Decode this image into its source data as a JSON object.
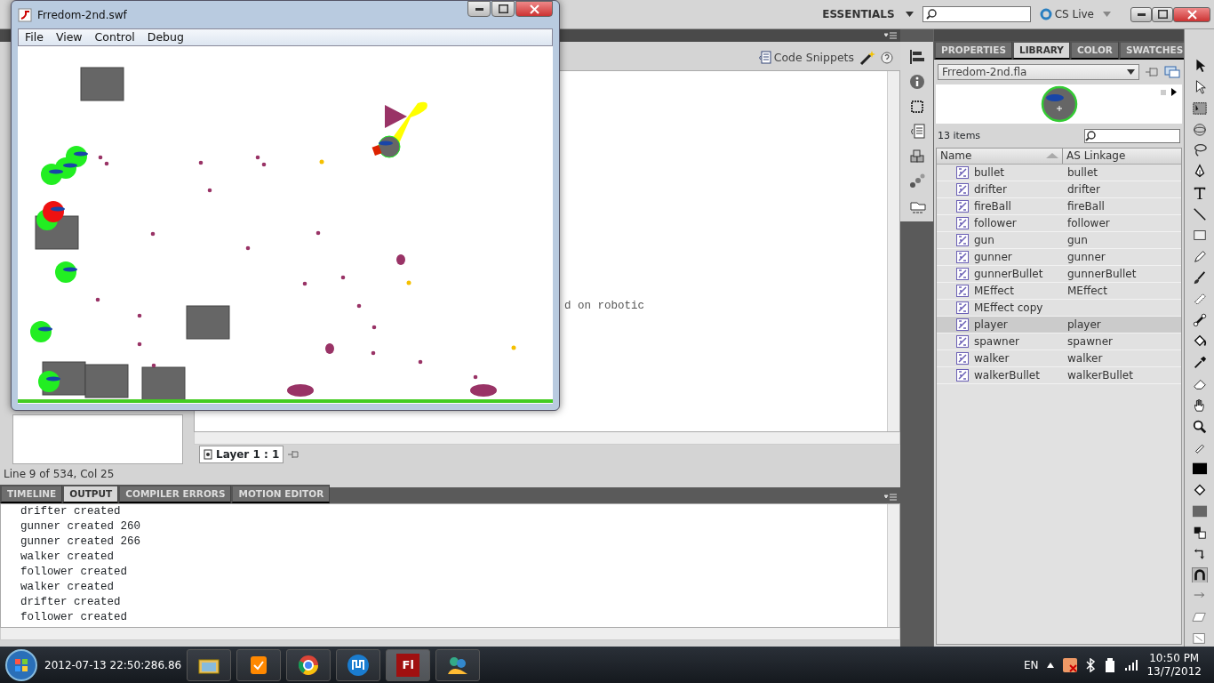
{
  "app_bar": {
    "workspace": "ESSENTIALS",
    "cs_live": "CS Live"
  },
  "swf_window": {
    "title": "Frredom-2nd.swf",
    "menu": [
      "File",
      "View",
      "Control",
      "Debug"
    ]
  },
  "editor": {
    "code_snippets": "Code Snippets",
    "code_lines": [
      "d on robotic"
    ],
    "layer_tab": "Layer 1 : 1",
    "status": "Line 9 of 534, Col 25"
  },
  "bottom_panel": {
    "tabs": [
      {
        "label": "TIMELINE",
        "selected": false
      },
      {
        "label": "OUTPUT",
        "selected": true
      },
      {
        "label": "COMPILER ERRORS",
        "selected": false
      },
      {
        "label": "MOTION EDITOR",
        "selected": false
      }
    ],
    "output_lines": [
      "drifter created",
      "gunner created 260",
      "gunner created 266",
      "walker created",
      "follower created",
      "walker created",
      "drifter created",
      "follower created"
    ]
  },
  "library_panel": {
    "tabs": [
      {
        "label": "PROPERTIES",
        "selected": false
      },
      {
        "label": "LIBRARY",
        "selected": true
      },
      {
        "label": "COLOR",
        "selected": false
      },
      {
        "label": "SWATCHES",
        "selected": false
      }
    ],
    "document": "Frredom-2nd.fla",
    "item_count": "13 items",
    "columns": [
      "Name",
      "AS Linkage"
    ],
    "rows": [
      {
        "name": "bullet",
        "linkage": "bullet",
        "selected": false
      },
      {
        "name": "drifter",
        "linkage": "drifter",
        "selected": false
      },
      {
        "name": "fireBall",
        "linkage": "fireBall",
        "selected": false
      },
      {
        "name": "follower",
        "linkage": "follower",
        "selected": false
      },
      {
        "name": "gun",
        "linkage": "gun",
        "selected": false
      },
      {
        "name": "gunner",
        "linkage": "gunner",
        "selected": false
      },
      {
        "name": "gunnerBullet",
        "linkage": "gunnerBullet",
        "selected": false
      },
      {
        "name": "MEffect",
        "linkage": "MEffect",
        "selected": false
      },
      {
        "name": "MEffect copy",
        "selected": false
      },
      {
        "name": "player",
        "linkage": "player",
        "selected": true
      },
      {
        "name": "spawner",
        "linkage": "spawner",
        "selected": false
      },
      {
        "name": "walker",
        "linkage": "walker",
        "selected": false
      },
      {
        "name": "walkerBullet",
        "linkage": "walkerBullet",
        "selected": false
      }
    ]
  },
  "taskbar": {
    "overlay_time": "2012-07-13 22:50:286.86",
    "flash_icon_text": "Fl",
    "language": "EN",
    "time": "10:50 PM",
    "date": "13/7/2012"
  }
}
